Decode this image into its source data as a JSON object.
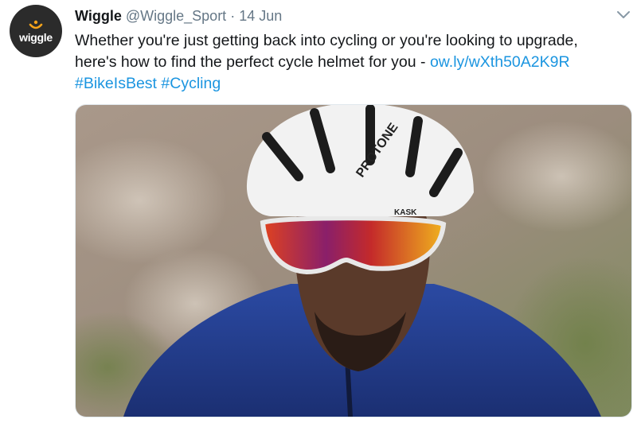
{
  "tweet": {
    "avatar_text": "wiggle",
    "display_name": "Wiggle",
    "handle": "@Wiggle_Sport",
    "separator": "·",
    "date": "14 Jun",
    "text_line1": "Whether you're just getting back into cycling or you're looking to upgrade,",
    "text_line2": "here's how to find the perfect cycle helmet for you - ",
    "link": "ow.ly/wXth50A2K9R",
    "hashtag1": "#BikeIsBest",
    "hashtag2": "#Cycling",
    "media": {
      "helmet_brand": "PROTONE",
      "helmet_maker": "KASK"
    }
  },
  "colors": {
    "link": "#1b95e0",
    "secondary_text": "#657786",
    "logo_accent": "#f5a31a",
    "avatar_bg": "#2b2b2b"
  },
  "icons": {
    "caret": "chevron-down-icon"
  }
}
